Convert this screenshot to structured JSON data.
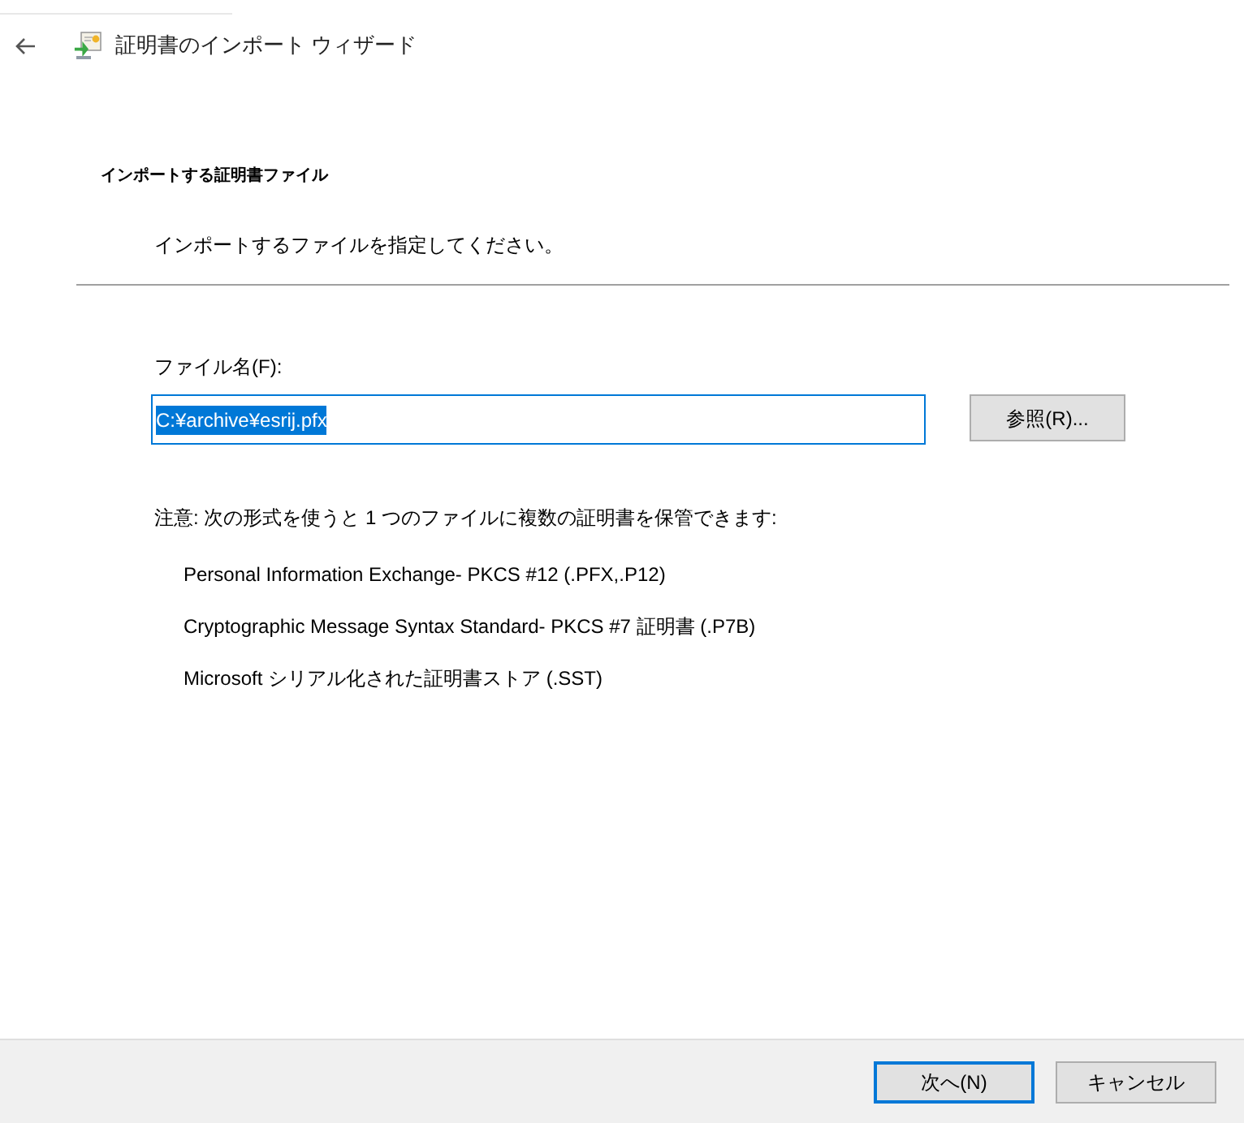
{
  "window": {
    "title": "証明書のインポート ウィザード"
  },
  "page": {
    "heading": "インポートする証明書ファイル",
    "subheading": "インポートするファイルを指定してください。"
  },
  "file_field": {
    "label": "ファイル名(F):",
    "value": "C:¥archive¥esrij.pfx",
    "text_selected": true
  },
  "browse_button": {
    "label": "参照(R)..."
  },
  "note": "注意: 次の形式を使うと 1 つのファイルに複数の証明書を保管できます:",
  "formats": [
    "Personal Information Exchange- PKCS #12 (.PFX,.P12)",
    "Cryptographic Message Syntax Standard- PKCS #7 証明書 (.P7B)",
    "Microsoft シリアル化された証明書ストア (.SST)"
  ],
  "buttons": [
    {
      "label": "次へ(N)",
      "default": true
    },
    {
      "label": "キャンセル",
      "default": false
    }
  ]
}
